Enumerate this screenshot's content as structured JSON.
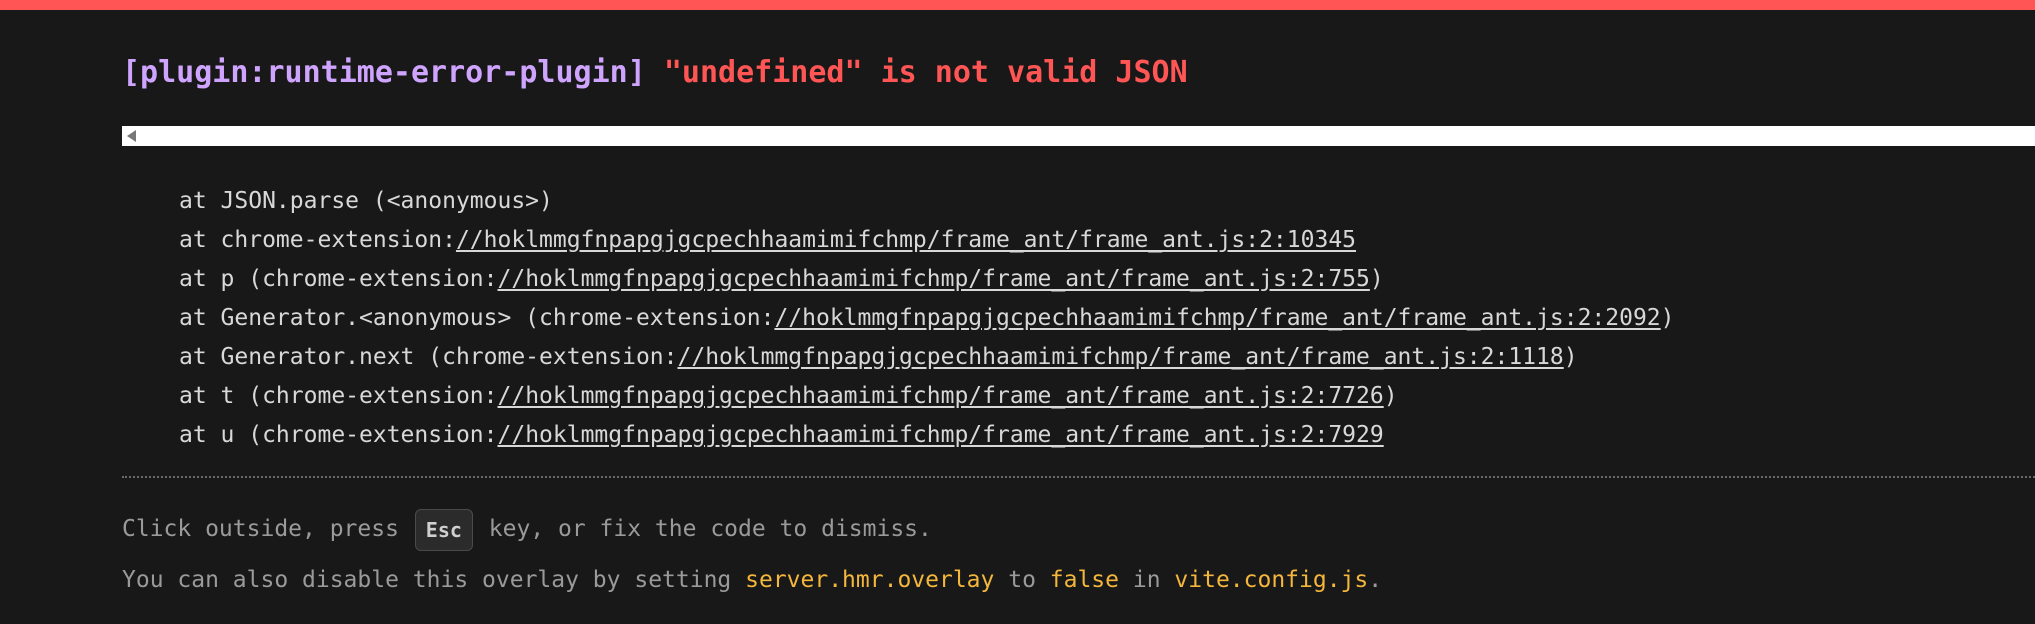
{
  "colors": {
    "accent_bar": "#ff5555",
    "plugin": "#cfa4ff",
    "message": "#ff5555",
    "code": "#f4b63b"
  },
  "error": {
    "plugin": "[plugin:runtime-error-plugin]",
    "message": "\"undefined\" is not valid JSON"
  },
  "stack": [
    {
      "prefix": "at JSON.parse (<anonymous>)",
      "link": "",
      "suffix": ""
    },
    {
      "prefix": "at chrome-extension:",
      "link": "//hoklmmgfnpapgjgcpechhaamimifchmp/frame_ant/frame_ant.js:2:10345",
      "suffix": ""
    },
    {
      "prefix": "at p (chrome-extension:",
      "link": "//hoklmmgfnpapgjgcpechhaamimifchmp/frame_ant/frame_ant.js:2:755",
      "suffix": ")"
    },
    {
      "prefix": "at Generator.<anonymous> (chrome-extension:",
      "link": "//hoklmmgfnpapgjgcpechhaamimifchmp/frame_ant/frame_ant.js:2:2092",
      "suffix": ")"
    },
    {
      "prefix": "at Generator.next (chrome-extension:",
      "link": "//hoklmmgfnpapgjgcpechhaamimifchmp/frame_ant/frame_ant.js:2:1118",
      "suffix": ")"
    },
    {
      "prefix": "at t (chrome-extension:",
      "link": "//hoklmmgfnpapgjgcpechhaamimifchmp/frame_ant/frame_ant.js:2:7726",
      "suffix": ")"
    },
    {
      "prefix": "at u (chrome-extension:",
      "link": "//hoklmmgfnpapgjgcpechhaamimifchmp/frame_ant/frame_ant.js:2:7929",
      "suffix": ""
    }
  ],
  "tip1": {
    "before": "Click outside, press ",
    "key": "Esc",
    "after": " key, or fix the code to dismiss."
  },
  "tip2": {
    "part1": "You can also disable this overlay by setting ",
    "code1": "server.hmr.overlay",
    "part2": " to ",
    "code2": "false",
    "part3": " in ",
    "code3": "vite.config.js",
    "part4": "."
  }
}
